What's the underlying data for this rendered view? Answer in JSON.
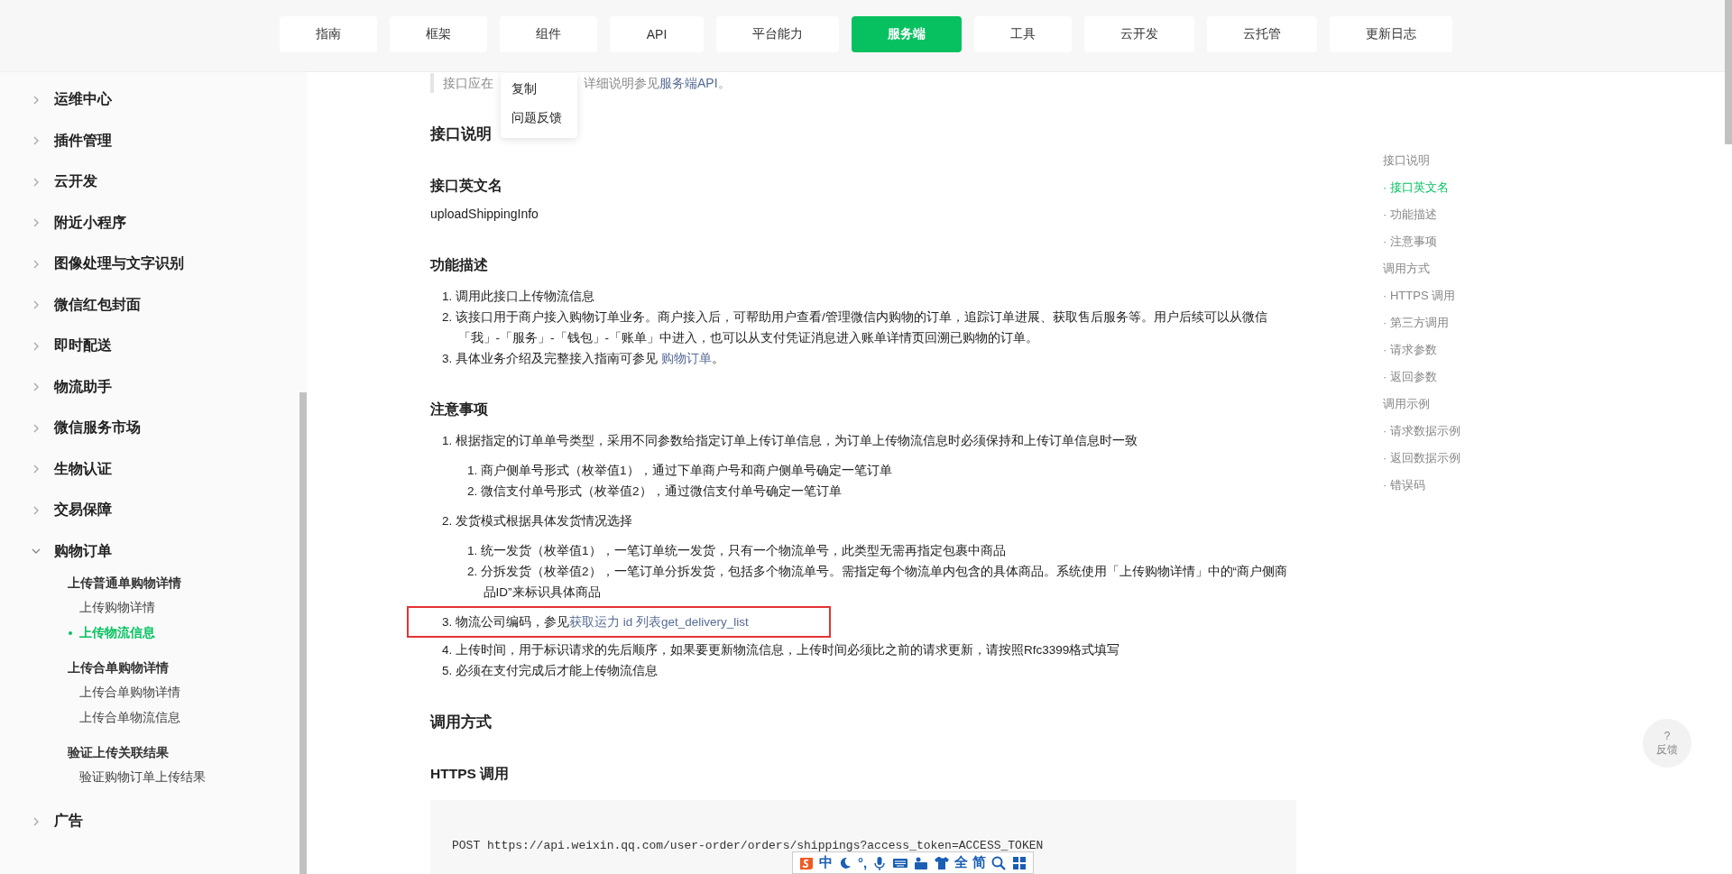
{
  "nav": {
    "tabs": [
      {
        "label": "指南",
        "selected": false
      },
      {
        "label": "框架",
        "selected": false
      },
      {
        "label": "组件",
        "selected": false
      },
      {
        "label": "API",
        "selected": false
      },
      {
        "label": "平台能力",
        "selected": false
      },
      {
        "label": "服务端",
        "selected": true
      },
      {
        "label": "工具",
        "selected": false
      },
      {
        "label": "云开发",
        "selected": false
      },
      {
        "label": "云托管",
        "selected": false
      },
      {
        "label": "更新日志",
        "selected": false
      }
    ]
  },
  "sidebar": {
    "items": [
      {
        "label": "运维中心",
        "expanded": false
      },
      {
        "label": "插件管理",
        "expanded": false
      },
      {
        "label": "云开发",
        "expanded": false
      },
      {
        "label": "附近小程序",
        "expanded": false
      },
      {
        "label": "图像处理与文字识别",
        "expanded": false
      },
      {
        "label": "微信红包封面",
        "expanded": false
      },
      {
        "label": "即时配送",
        "expanded": false
      },
      {
        "label": "物流助手",
        "expanded": false
      },
      {
        "label": "微信服务市场",
        "expanded": false
      },
      {
        "label": "生物认证",
        "expanded": false
      },
      {
        "label": "交易保障",
        "expanded": false
      },
      {
        "label": "购物订单",
        "expanded": true,
        "children": [
          {
            "label": "上传普通单购物详情",
            "children": [
              {
                "label": "上传购物详情",
                "selected": false
              },
              {
                "label": "上传物流信息",
                "selected": true
              }
            ]
          },
          {
            "label": "上传合单购物详情",
            "children": [
              {
                "label": "上传合单购物详情",
                "selected": false
              },
              {
                "label": "上传合单物流信息",
                "selected": false
              }
            ]
          },
          {
            "label": "验证上传关联结果",
            "children": [
              {
                "label": "验证购物订单上传结果",
                "selected": false
              }
            ]
          }
        ]
      },
      {
        "label": "广告",
        "expanded": false
      }
    ]
  },
  "context_menu": {
    "items": [
      "复制",
      "问题反馈"
    ]
  },
  "quote": {
    "start": "接口应在",
    "text": "详细说明参见",
    "link": "服务端API",
    "after": "。"
  },
  "content": [
    {
      "kind": "h2",
      "text": "接口说明"
    },
    {
      "kind": "h3",
      "text": "接口英文名"
    },
    {
      "kind": "p",
      "text": "uploadShippingInfo"
    },
    {
      "kind": "h3",
      "text": "功能描述"
    },
    {
      "kind": "ol",
      "items": [
        {
          "text": "1. 调用此接口上传物流信息"
        },
        {
          "text": "2. 该接口用于商户接入购物订单业务。商户接入后，可帮助用户查看/管理微信内购物的订单，追踪订单进展、获取售后服务等。用户后续可以从微信「我」-「服务」-「钱包」-「账单」中进入，也可以从支付凭证消息进入账单详情页回溯已购物的订单。"
        },
        {
          "text": "3. 具体业务介绍及完整接入指南可参见 ",
          "link": "购物订单",
          "after": "。"
        }
      ]
    },
    {
      "kind": "h3",
      "text": "注意事项"
    },
    {
      "kind": "ol",
      "items": [
        {
          "text": "1. 根据指定的订单单号类型，采用不同参数给指定订单上传订单信息，为订单上传物流信息时必须保持和上传订单信息时一致",
          "children": [
            {
              "text": "1. 商户侧单号形式（枚举值1），通过下单商户号和商户侧单号确定一笔订单"
            },
            {
              "text": "2. 微信支付单号形式（枚举值2），通过微信支付单号确定一笔订单"
            }
          ]
        },
        {
          "text": "2. 发货模式根据具体发货情况选择",
          "children": [
            {
              "text": "1. 统一发货（枚举值1），一笔订单统一发货，只有一个物流单号，此类型无需再指定包裹中商品"
            },
            {
              "text": "2. 分拆发货（枚举值2），一笔订单分拆发货，包括多个物流单号。需指定每个物流单内包含的具体商品。系统使用「上传购物详情」中的“商户侧商品ID”来标识具体商品"
            }
          ]
        },
        {
          "text": "3. 物流公司编码，参见",
          "link": "获取运力 id 列表get_delivery_list",
          "highlighted": true
        },
        {
          "text": "4. 上传时间，用于标识请求的先后顺序，如果要更新物流信息，上传时间必须比之前的请求更新，请按照Rfc3399格式填写"
        },
        {
          "text": "5. 必须在支付完成后才能上传物流信息"
        }
      ]
    },
    {
      "kind": "h2",
      "text": "调用方式"
    },
    {
      "kind": "h3",
      "text": "HTTPS 调用"
    },
    {
      "kind": "code",
      "text": "POST https://api.weixin.qq.com/user-order/orders/shippings?access_token=ACCESS_TOKEN"
    }
  ],
  "toc": [
    {
      "label": "接口说明",
      "selected": false,
      "children": [
        {
          "label": "· 接口英文名",
          "selected": true
        },
        {
          "label": "· 功能描述",
          "selected": false
        },
        {
          "label": "· 注意事项",
          "selected": false
        }
      ]
    },
    {
      "label": "调用方式",
      "selected": false,
      "children": [
        {
          "label": "· HTTPS 调用",
          "selected": false
        },
        {
          "label": "· 第三方调用",
          "selected": false
        },
        {
          "label": "· 请求参数",
          "selected": false
        },
        {
          "label": "· 返回参数",
          "selected": false
        }
      ]
    },
    {
      "label": "调用示例",
      "selected": false,
      "children": [
        {
          "label": "· 请求数据示例",
          "selected": false
        },
        {
          "label": "· 返回数据示例",
          "selected": false
        },
        {
          "label": "· 错误码",
          "selected": false
        }
      ]
    }
  ],
  "feedback": {
    "icon_text": "?",
    "label": "反馈"
  },
  "ime_toolbar": [
    {
      "kind": "logo"
    },
    {
      "kind": "text",
      "label": "中"
    },
    {
      "kind": "moon"
    },
    {
      "kind": "text",
      "label": "°,"
    },
    {
      "kind": "mic"
    },
    {
      "kind": "keyboard"
    },
    {
      "kind": "toolbox"
    },
    {
      "kind": "shirt"
    },
    {
      "kind": "text",
      "label": "全"
    },
    {
      "kind": "text",
      "label": "简"
    },
    {
      "kind": "search"
    },
    {
      "kind": "grid"
    }
  ]
}
